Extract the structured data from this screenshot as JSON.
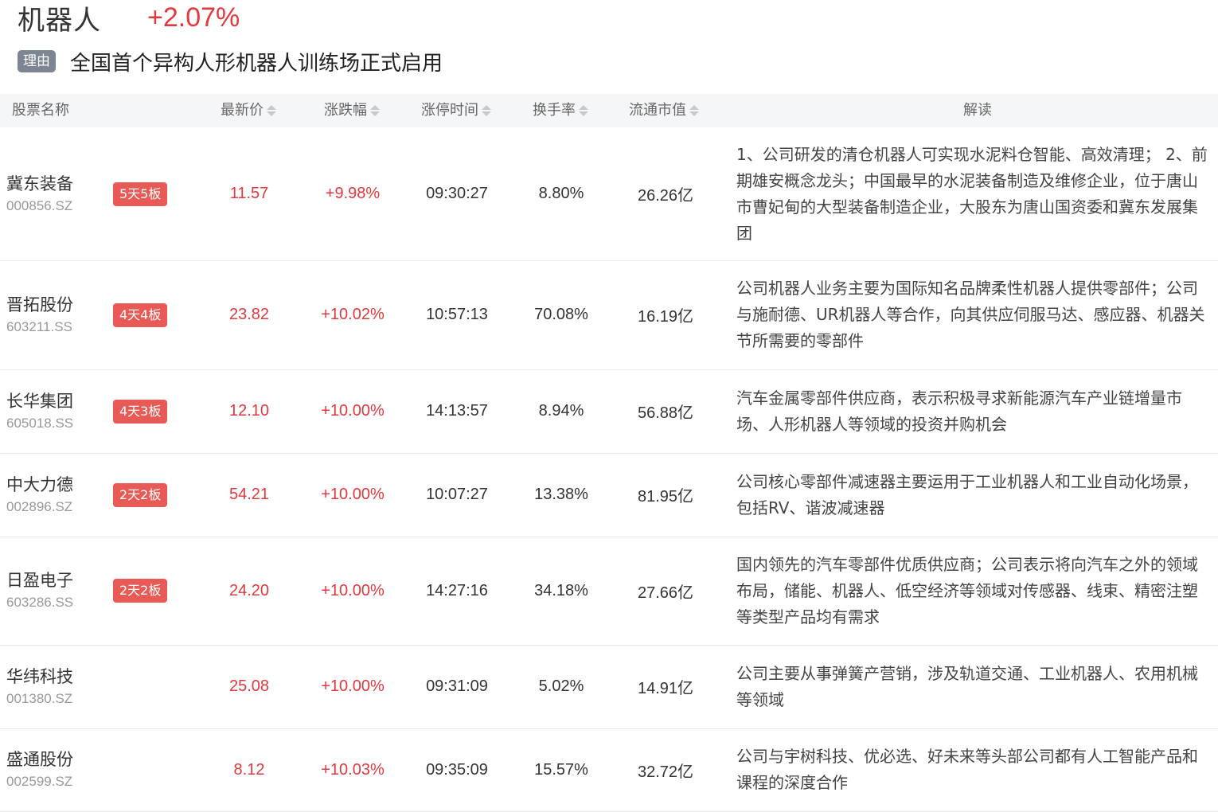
{
  "sector": {
    "name": "机器人",
    "change": "+2.07%"
  },
  "reason": {
    "tag": "理由",
    "text": "全国首个异构人形机器人训练场正式启用"
  },
  "columns": {
    "name": "股票名称",
    "price": "最新价",
    "change": "涨跌幅",
    "limit_time": "涨停时间",
    "turnover": "换手率",
    "float_cap": "流通市值",
    "interpretation": "解读"
  },
  "rows": [
    {
      "name": "冀东装备",
      "code": "000856.SZ",
      "badge": "5天5板",
      "price": "11.57",
      "change": "+9.98%",
      "time": "09:30:27",
      "turnover": "8.80%",
      "cap": "26.26亿",
      "text": "1、公司研发的清仓机器人可实现水泥料仓智能、高效清理； 2、前期雄安概念龙头；中国最早的水泥装备制造及维修企业，位于唐山市曹妃甸的大型装备制造企业，大股东为唐山国资委和冀东发展集团"
    },
    {
      "name": "晋拓股份",
      "code": "603211.SS",
      "badge": "4天4板",
      "price": "23.82",
      "change": "+10.02%",
      "time": "10:57:13",
      "turnover": "70.08%",
      "cap": "16.19亿",
      "text": "公司机器人业务主要为国际知名品牌柔性机器人提供零部件；公司与施耐德、UR机器人等合作，向其供应伺服马达、感应器、机器关节所需要的零部件"
    },
    {
      "name": "长华集团",
      "code": "605018.SS",
      "badge": "4天3板",
      "price": "12.10",
      "change": "+10.00%",
      "time": "14:13:57",
      "turnover": "8.94%",
      "cap": "56.88亿",
      "text": "汽车金属零部件供应商，表示积极寻求新能源汽车产业链增量市场、人形机器人等领域的投资并购机会"
    },
    {
      "name": "中大力德",
      "code": "002896.SZ",
      "badge": "2天2板",
      "price": "54.21",
      "change": "+10.00%",
      "time": "10:07:27",
      "turnover": "13.38%",
      "cap": "81.95亿",
      "text": "公司核心零部件减速器主要运用于工业机器人和工业自动化场景，包括RV、谐波减速器"
    },
    {
      "name": "日盈电子",
      "code": "603286.SS",
      "badge": "2天2板",
      "price": "24.20",
      "change": "+10.00%",
      "time": "14:27:16",
      "turnover": "34.18%",
      "cap": "27.66亿",
      "text": "国内领先的汽车零部件优质供应商；公司表示将向汽车之外的领域布局，储能、机器人、低空经济等领域对传感器、线束、精密注塑等类型产品均有需求"
    },
    {
      "name": "华纬科技",
      "code": "001380.SZ",
      "badge": "",
      "price": "25.08",
      "change": "+10.00%",
      "time": "09:31:09",
      "turnover": "5.02%",
      "cap": "14.91亿",
      "text": "公司主要从事弹簧产营销，涉及轨道交通、工业机器人、农用机械等领域"
    },
    {
      "name": "盛通股份",
      "code": "002599.SZ",
      "badge": "",
      "price": "8.12",
      "change": "+10.03%",
      "time": "09:35:09",
      "turnover": "15.57%",
      "cap": "32.72亿",
      "text": "公司与宇树科技、优必选、好未来等头部公司都有人工智能产品和课程的深度合作"
    }
  ],
  "colors": {
    "up": "#e0393e",
    "badge": "#e85a55",
    "tag": "#7d8593",
    "header_bg": "#f5f6f8"
  },
  "icons": {
    "sort": "sort-caret-icon"
  }
}
